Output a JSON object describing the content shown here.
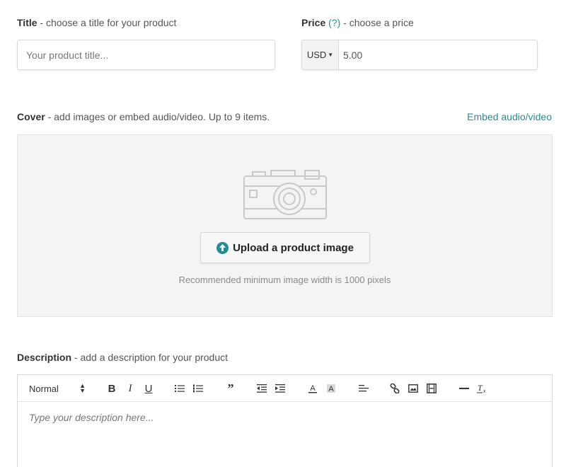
{
  "title_field": {
    "label_bold": "Title",
    "label_rest": " - choose a title for your product",
    "placeholder": "Your product title..."
  },
  "price_field": {
    "label_bold": "Price",
    "help": "(?)",
    "label_rest": " - choose a price",
    "currency": "USD",
    "value": "5.00"
  },
  "cover": {
    "label_bold": "Cover",
    "label_rest": " - add images or embed audio/video. Up to 9 items.",
    "embed_link": "Embed audio/video",
    "upload_button": "Upload a product image",
    "recommendation": "Recommended minimum image width is 1000 pixels"
  },
  "description": {
    "label_bold": "Description",
    "label_rest": " - add a description for your product",
    "placeholder": "Type your description here...",
    "toolbar": {
      "format": "Normal",
      "items": [
        "bold-icon",
        "italic-icon",
        "underline-icon",
        "bullet-list-icon",
        "numbered-list-icon",
        "blockquote-icon",
        "outdent-icon",
        "indent-icon",
        "text-color-icon",
        "background-color-icon",
        "align-icon",
        "link-icon",
        "image-icon",
        "video-icon",
        "horizontal-rule-icon",
        "clear-format-icon"
      ]
    }
  },
  "colors": {
    "accent": "#2a8a94",
    "cover_bg": "#f4f4f4"
  }
}
